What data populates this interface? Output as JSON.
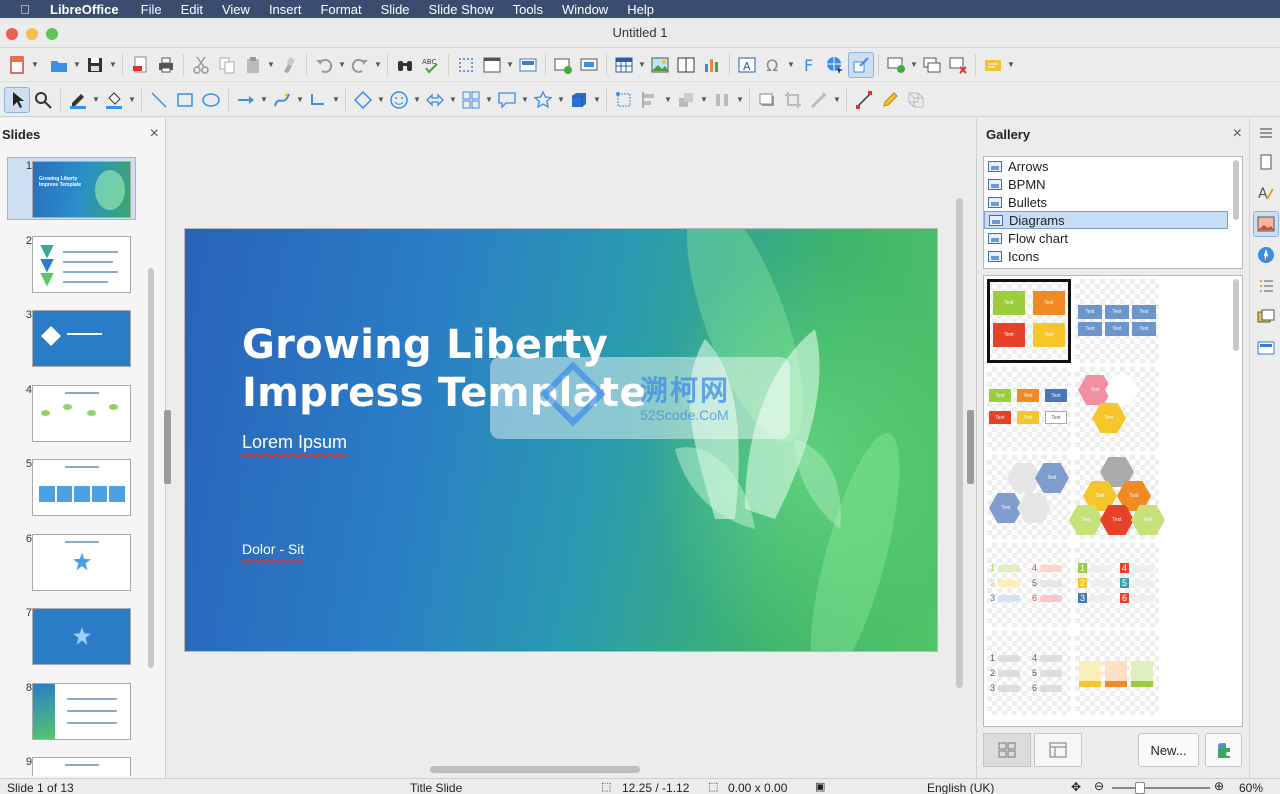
{
  "menubar": {
    "app_name": "LibreOffice",
    "items": [
      "File",
      "Edit",
      "View",
      "Insert",
      "Format",
      "Slide",
      "Slide Show",
      "Tools",
      "Window",
      "Help"
    ]
  },
  "window": {
    "title": "Untitled 1"
  },
  "slides_pane": {
    "title": "Slides",
    "slides": [
      {
        "num": "1",
        "style": "title",
        "title": "Growing Liberty Impress Template"
      },
      {
        "num": "2",
        "style": "white"
      },
      {
        "num": "3",
        "style": "blue"
      },
      {
        "num": "4",
        "style": "white"
      },
      {
        "num": "5",
        "style": "white"
      },
      {
        "num": "6",
        "style": "white"
      },
      {
        "num": "7",
        "style": "blue"
      },
      {
        "num": "8",
        "style": "white"
      },
      {
        "num": "9",
        "style": "white"
      }
    ]
  },
  "slide": {
    "title_line1": "Growing Liberty",
    "title_line2": "Impress Template",
    "subtitle": "Lorem Ipsum",
    "footer": "Dolor - Sit",
    "watermark_text": "溯柯网",
    "watermark_sub": "52Scode.CoM"
  },
  "gallery": {
    "title": "Gallery",
    "themes": [
      "Arrows",
      "BPMN",
      "Bullets",
      "Diagrams",
      "Flow chart",
      "Icons"
    ],
    "selected_theme": "Diagrams",
    "new_button": "New...",
    "box_text": "Text"
  },
  "statusbar": {
    "slide_info": "Slide 1 of 13",
    "layout": "Title Slide",
    "position": "12.25 / -1.12",
    "size": "0.00 x 0.00",
    "language": "English (UK)",
    "zoom": "60%"
  },
  "colors": {
    "menubar_bg": "#3a4d6e",
    "selection": "#c7dcf5",
    "slide_gradient_start": "#2a63b8",
    "slide_gradient_end": "#52c46a"
  }
}
